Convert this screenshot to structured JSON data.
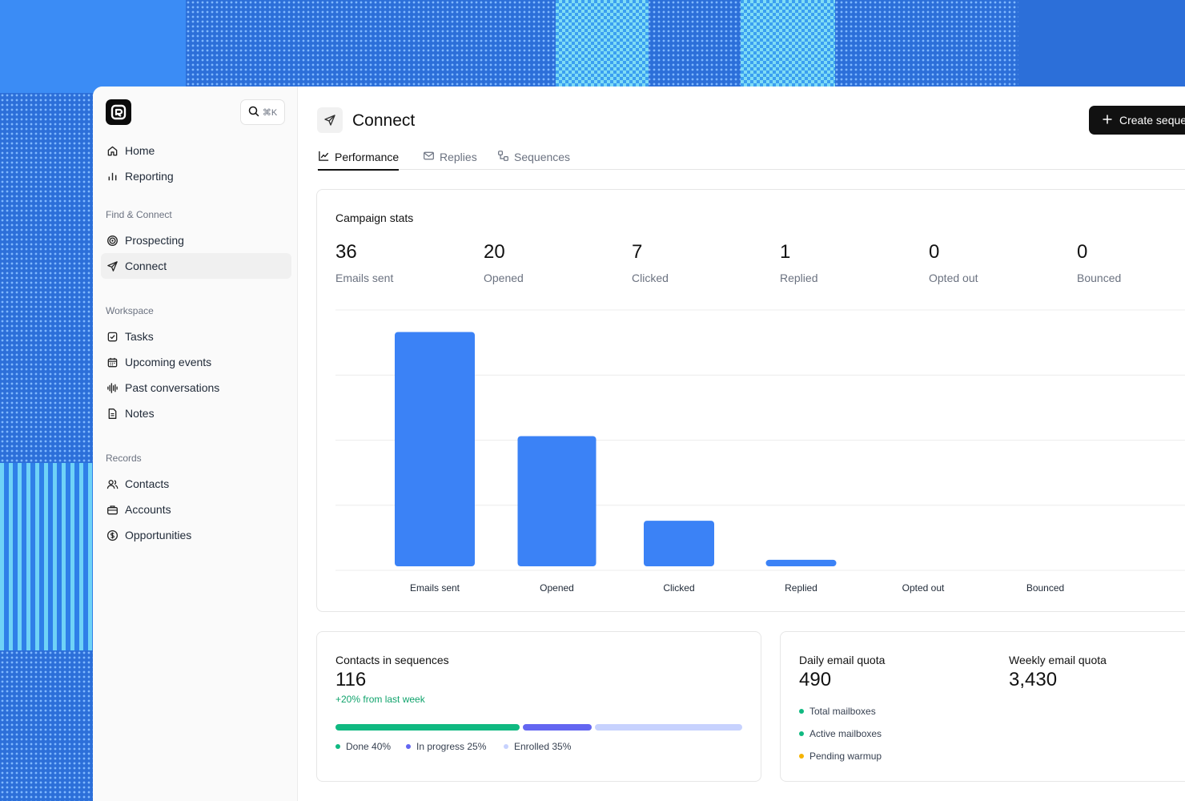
{
  "colors": {
    "accent": "#3b82f6",
    "done": "#10b981",
    "in_progress": "#6366f1",
    "enrolled": "#c7d2fe",
    "warmup": "#f5b300",
    "delta": "#10a36c"
  },
  "sidebar": {
    "search_shortcut": "⌘K",
    "items_top": [
      {
        "label": "Home",
        "icon": "home-icon"
      },
      {
        "label": "Reporting",
        "icon": "bar-chart-icon"
      }
    ],
    "find_connect_label": "Find & Connect",
    "find_connect": [
      {
        "label": "Prospecting",
        "icon": "target-icon"
      },
      {
        "label": "Connect",
        "icon": "send-icon"
      }
    ],
    "workspace_label": "Workspace",
    "workspace": [
      {
        "label": "Tasks",
        "icon": "checkbox-icon"
      },
      {
        "label": "Upcoming events",
        "icon": "calendar-icon"
      },
      {
        "label": "Past conversations",
        "icon": "waveform-icon"
      },
      {
        "label": "Notes",
        "icon": "document-icon"
      }
    ],
    "records_label": "Records",
    "records": [
      {
        "label": "Contacts",
        "icon": "users-icon"
      },
      {
        "label": "Accounts",
        "icon": "briefcase-icon"
      },
      {
        "label": "Opportunities",
        "icon": "dollar-icon"
      }
    ]
  },
  "header": {
    "title": "Connect",
    "create_label": "Create sequence",
    "tabs": [
      {
        "label": "Performance",
        "icon": "line-chart-icon",
        "active": true
      },
      {
        "label": "Replies",
        "icon": "mail-icon"
      },
      {
        "label": "Sequences",
        "icon": "sequence-icon"
      }
    ]
  },
  "campaign": {
    "title": "Campaign stats",
    "stats": [
      {
        "value": "36",
        "label": "Emails sent"
      },
      {
        "value": "20",
        "label": "Opened"
      },
      {
        "value": "7",
        "label": "Clicked"
      },
      {
        "value": "1",
        "label": "Replied"
      },
      {
        "value": "0",
        "label": "Opted out"
      },
      {
        "value": "0",
        "label": "Bounced"
      }
    ]
  },
  "chart_data": {
    "type": "bar",
    "categories": [
      "Emails sent",
      "Opened",
      "Clicked",
      "Replied",
      "Opted out",
      "Bounced"
    ],
    "values": [
      36,
      20,
      7,
      1,
      0,
      0
    ],
    "title": "",
    "xlabel": "",
    "ylabel": "",
    "ylim": [
      0,
      40
    ],
    "grid": true,
    "legend": "none"
  },
  "contacts": {
    "title": "Contacts in sequences",
    "value": "116",
    "delta": "+20% from last week",
    "progress": [
      {
        "label": "Done 40%",
        "fraction": 0.4
      },
      {
        "label": "In progress 25%",
        "fraction": 0.15
      },
      {
        "label": "Enrolled 35%",
        "fraction": 0.32
      }
    ]
  },
  "quota": {
    "daily_title": "Daily email quota",
    "daily_value": "490",
    "weekly_title": "Weekly email quota",
    "weekly_value": "3,430",
    "mailboxes": [
      {
        "label": "Total mailboxes"
      },
      {
        "label": "Active mailboxes"
      },
      {
        "label": "Pending warmup"
      }
    ]
  }
}
